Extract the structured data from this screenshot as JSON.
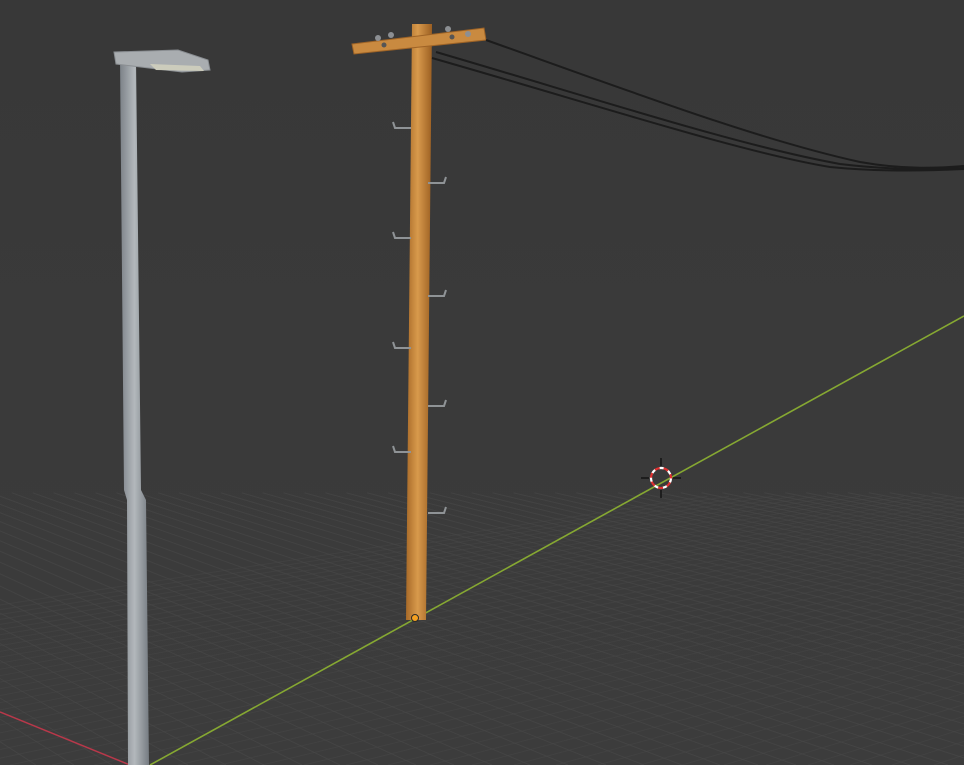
{
  "viewport": {
    "background_color": "#3b3b3b",
    "grid_color": "#4a4a4a",
    "x_axis_color": "#c0394a",
    "y_axis_color": "#8fb332"
  },
  "objects": [
    {
      "name": "street-lamp",
      "material_color": "#9aa0a5"
    },
    {
      "name": "utility-pole",
      "material_color": "#c88a3e"
    },
    {
      "name": "power-lines",
      "material_color": "#1e1e1e"
    }
  ],
  "icons": {
    "cursor": "3d-cursor-icon",
    "origin": "object-origin-icon"
  }
}
